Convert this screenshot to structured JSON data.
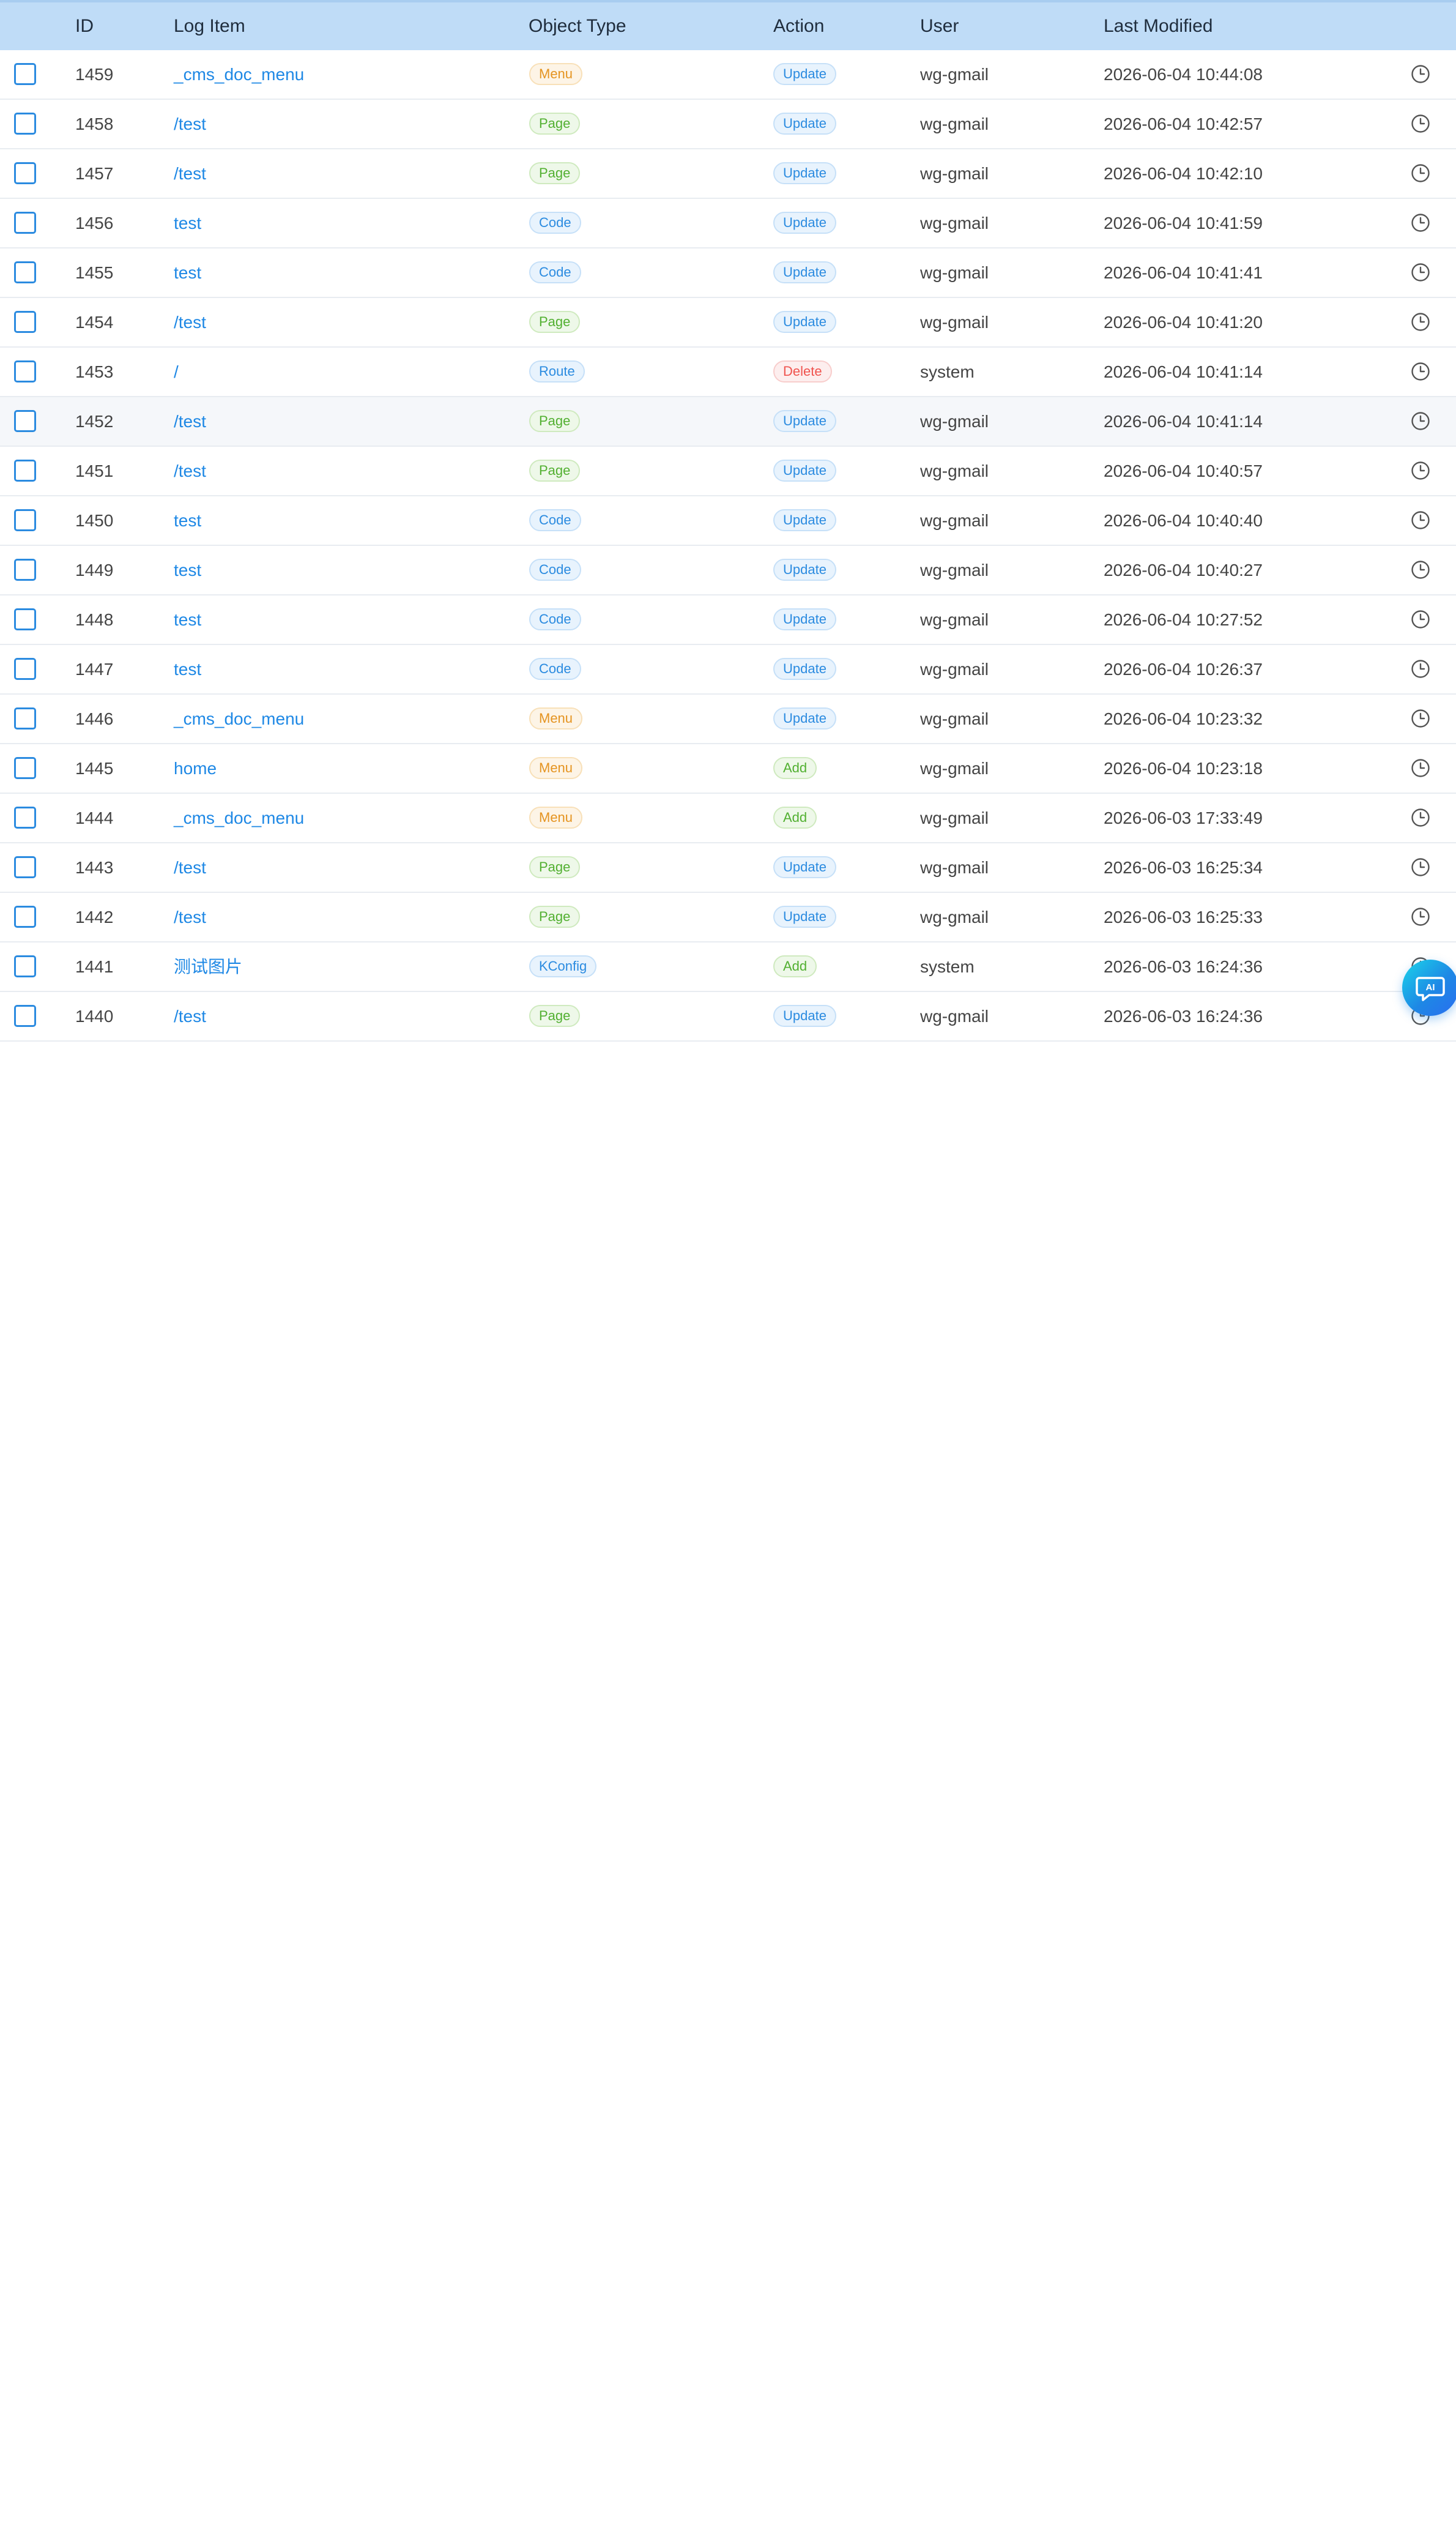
{
  "table": {
    "columns": {
      "id": "ID",
      "log_item": "Log Item",
      "object_type": "Object Type",
      "action": "Action",
      "user": "User",
      "last_modified": "Last Modified"
    },
    "rows": [
      {
        "id": "1459",
        "log_item": "_cms_doc_menu",
        "object_type": "Menu",
        "action": "Update",
        "user": "wg-gmail",
        "last_modified": "2026-06-04 10:44:08"
      },
      {
        "id": "1458",
        "log_item": "/test",
        "object_type": "Page",
        "action": "Update",
        "user": "wg-gmail",
        "last_modified": "2026-06-04 10:42:57"
      },
      {
        "id": "1457",
        "log_item": "/test",
        "object_type": "Page",
        "action": "Update",
        "user": "wg-gmail",
        "last_modified": "2026-06-04 10:42:10"
      },
      {
        "id": "1456",
        "log_item": "test",
        "object_type": "Code",
        "action": "Update",
        "user": "wg-gmail",
        "last_modified": "2026-06-04 10:41:59"
      },
      {
        "id": "1455",
        "log_item": "test",
        "object_type": "Code",
        "action": "Update",
        "user": "wg-gmail",
        "last_modified": "2026-06-04 10:41:41"
      },
      {
        "id": "1454",
        "log_item": "/test",
        "object_type": "Page",
        "action": "Update",
        "user": "wg-gmail",
        "last_modified": "2026-06-04 10:41:20"
      },
      {
        "id": "1453",
        "log_item": "/",
        "object_type": "Route",
        "action": "Delete",
        "user": "system",
        "last_modified": "2026-06-04 10:41:14"
      },
      {
        "id": "1452",
        "log_item": "/test",
        "object_type": "Page",
        "action": "Update",
        "user": "wg-gmail",
        "last_modified": "2026-06-04 10:41:14"
      },
      {
        "id": "1451",
        "log_item": "/test",
        "object_type": "Page",
        "action": "Update",
        "user": "wg-gmail",
        "last_modified": "2026-06-04 10:40:57"
      },
      {
        "id": "1450",
        "log_item": "test",
        "object_type": "Code",
        "action": "Update",
        "user": "wg-gmail",
        "last_modified": "2026-06-04 10:40:40"
      },
      {
        "id": "1449",
        "log_item": "test",
        "object_type": "Code",
        "action": "Update",
        "user": "wg-gmail",
        "last_modified": "2026-06-04 10:40:27"
      },
      {
        "id": "1448",
        "log_item": "test",
        "object_type": "Code",
        "action": "Update",
        "user": "wg-gmail",
        "last_modified": "2026-06-04 10:27:52"
      },
      {
        "id": "1447",
        "log_item": "test",
        "object_type": "Code",
        "action": "Update",
        "user": "wg-gmail",
        "last_modified": "2026-06-04 10:26:37"
      },
      {
        "id": "1446",
        "log_item": "_cms_doc_menu",
        "object_type": "Menu",
        "action": "Update",
        "user": "wg-gmail",
        "last_modified": "2026-06-04 10:23:32"
      },
      {
        "id": "1445",
        "log_item": "home",
        "object_type": "Menu",
        "action": "Add",
        "user": "wg-gmail",
        "last_modified": "2026-06-04 10:23:18"
      },
      {
        "id": "1444",
        "log_item": "_cms_doc_menu",
        "object_type": "Menu",
        "action": "Add",
        "user": "wg-gmail",
        "last_modified": "2026-06-03 17:33:49"
      },
      {
        "id": "1443",
        "log_item": "/test",
        "object_type": "Page",
        "action": "Update",
        "user": "wg-gmail",
        "last_modified": "2026-06-03 16:25:34"
      },
      {
        "id": "1442",
        "log_item": "/test",
        "object_type": "Page",
        "action": "Update",
        "user": "wg-gmail",
        "last_modified": "2026-06-03 16:25:33"
      },
      {
        "id": "1441",
        "log_item": "测试图片",
        "object_type": "KConfig",
        "action": "Add",
        "user": "system",
        "last_modified": "2026-06-03 16:24:36"
      },
      {
        "id": "1440",
        "log_item": "/test",
        "object_type": "Page",
        "action": "Update",
        "user": "wg-gmail",
        "last_modified": "2026-06-03 16:24:36"
      }
    ]
  },
  "row_icon": "clock-icon",
  "ai_button": {
    "label": "AI",
    "icon": "ai-chat-icon"
  },
  "colors": {
    "header_bg": "#bfdcf7",
    "link": "#1e88e5",
    "accent": "#2b8be0",
    "menu_tag": "#e59421",
    "page_tag": "#52b031",
    "delete_tag": "#f0544f"
  }
}
